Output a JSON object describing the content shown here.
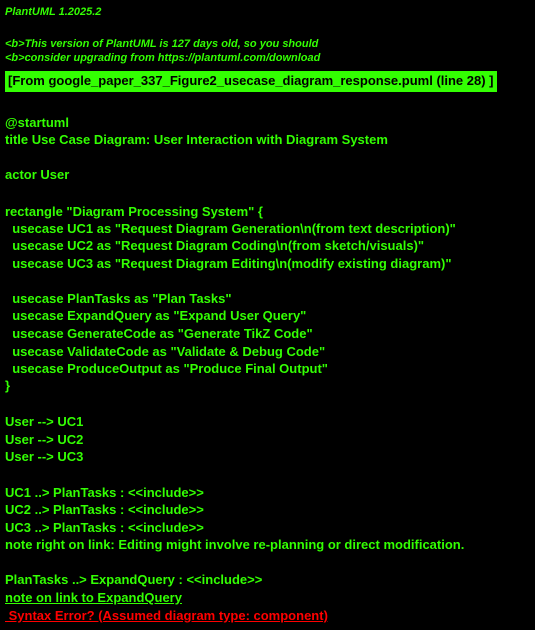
{
  "header": {
    "version": "PlantUML 1.2025.2",
    "warning_line1": "<b>This version of PlantUML is 127 days old, so you should",
    "warning_line2": "<b>consider upgrading from https://plantuml.com/download"
  },
  "banner": {
    "text": "[From google_paper_337_Figure2_usecase_diagram_response.puml (line 28) ]"
  },
  "source_lines": [
    "@startuml",
    "title Use Case Diagram: User Interaction with Diagram System",
    "actor User",
    "rectangle \"Diagram Processing System\" {",
    "  usecase UC1 as \"Request Diagram Generation\\n(from text description)\"",
    "  usecase UC2 as \"Request Diagram Coding\\n(from sketch/visuals)\"",
    "  usecase UC3 as \"Request Diagram Editing\\n(modify existing diagram)\"",
    "  usecase PlanTasks as \"Plan Tasks\"",
    "  usecase ExpandQuery as \"Expand User Query\"",
    "  usecase GenerateCode as \"Generate TikZ Code\"",
    "  usecase ValidateCode as \"Validate & Debug Code\"",
    "  usecase ProduceOutput as \"Produce Final Output\"",
    "}",
    "User --> UC1",
    "User --> UC2",
    "User --> UC3",
    "UC1 ..> PlanTasks : <<include>>",
    "UC2 ..> PlanTasks : <<include>>",
    "UC3 ..> PlanTasks : <<include>>",
    "note right on link: Editing might involve re-planning or direct modification.",
    "PlanTasks ..> ExpandQuery : <<include>>",
    "note on link to ExpandQuery"
  ],
  "error": {
    "text": " Syntax Error? (Assumed diagram type: component)"
  },
  "colors": {
    "background": "#000000",
    "text": "#33FF02",
    "error": "#FF0000"
  }
}
